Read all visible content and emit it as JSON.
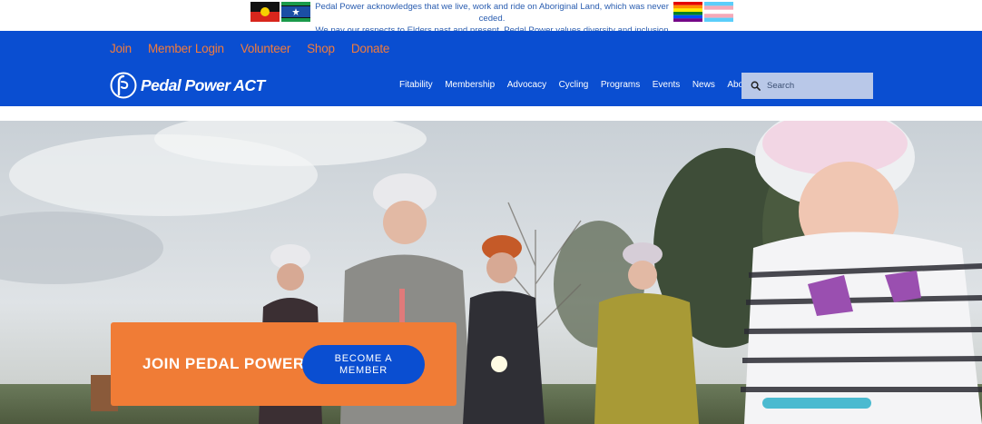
{
  "acknowledgement": {
    "line1": "Pedal Power acknowledges that we live, work and ride on Aboriginal Land, which was never ceded.",
    "line2": "We pay our respects to Elders past and present. Pedal Power values diversity and inclusion"
  },
  "top_links": [
    "Join",
    "Member Login",
    "Volunteer",
    "Shop",
    "Donate"
  ],
  "logo": {
    "text": "Pedal Power ACT"
  },
  "nav": [
    "Fitability",
    "Membership",
    "Advocacy",
    "Cycling",
    "Programs",
    "Events",
    "News",
    "About"
  ],
  "search": {
    "placeholder": "Search",
    "value": ""
  },
  "cta": {
    "title": "JOIN PEDAL POWER",
    "button_line1": "BECOME A",
    "button_line2": "MEMBER"
  },
  "colors": {
    "header_blue": "#0a4ed1",
    "accent_orange": "#f47b3a",
    "cta_orange": "#f07c36",
    "search_bg": "#b9c8e8"
  },
  "icons": {
    "search": "search-icon",
    "logo": "pedal-power-logo-icon"
  }
}
